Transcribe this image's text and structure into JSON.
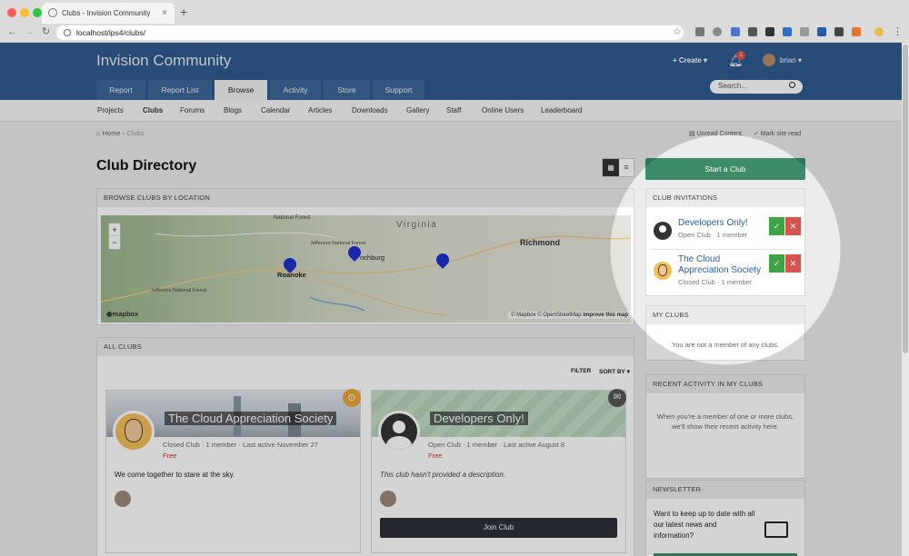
{
  "browser": {
    "tab_title": "Clubs - Invision Community",
    "url": "localhost/ips4/clubs/",
    "new_tab": "+"
  },
  "header": {
    "site_name": "Invision Community",
    "create_label": "Create",
    "notification_count": "1",
    "user_name": "brian",
    "search_placeholder": "Search...",
    "tabs": [
      "Report",
      "Report List",
      "Browse",
      "Activity",
      "Store",
      "Support"
    ],
    "active_tab": "Browse"
  },
  "subnav": {
    "items": [
      "Projects",
      "Clubs",
      "Forums",
      "Blogs",
      "Calendar",
      "Articles",
      "Downloads",
      "Gallery",
      "Staff",
      "Online Users",
      "Leaderboard"
    ],
    "active": "Clubs"
  },
  "breadcrumb": {
    "home": "Home",
    "current": "Clubs",
    "separator": "›",
    "unread": "Unread Content",
    "mark_read": "Mark site read"
  },
  "page_title": "Club Directory",
  "map": {
    "heading": "BROWSE CLUBS BY LOCATION",
    "labels": [
      "Virginia",
      "Richmond",
      "Roanoke",
      "nchburg",
      "National Forest",
      "Jefferson National Forest",
      "Jefferson National Forest"
    ],
    "zoom_in": "+",
    "zoom_out": "−",
    "brand": "mapbox",
    "attribution": "© Mapbox © OpenStreetMap",
    "improve": "Improve this map"
  },
  "all_clubs": {
    "heading": "ALL CLUBS",
    "filter": "FILTER",
    "sort": "SORT BY",
    "clubs": [
      {
        "name": "The Cloud Appreciation Society",
        "type": "Closed Club",
        "members": "1 member",
        "last_active": "Last active November 27",
        "price": "Free",
        "description": "We come together to stare at the sky."
      },
      {
        "name": "Developers Only!",
        "type": "Open Club",
        "members": "1 member",
        "last_active": "Last active August 8",
        "price": "Free",
        "description": "This club hasn't provided a description.",
        "join_label": "Join Club"
      }
    ]
  },
  "sidebar": {
    "start_club": "Start a Club",
    "invitations_heading": "CLUB INVITATIONS",
    "invitations": [
      {
        "name": "Developers Only!",
        "type": "Open Club",
        "members": "1 member"
      },
      {
        "name_line1": "The Cloud",
        "name_line2": "Appreciation Society",
        "type": "Closed Club",
        "members": "1 member"
      }
    ],
    "my_clubs_heading": "MY CLUBS",
    "my_clubs_empty": "You are not a member of any clubs.",
    "recent_heading": "RECENT ACTIVITY IN MY CLUBS",
    "recent_line1": "When you're a member of one or more clubs,",
    "recent_line2": "we'll show their recent activity here.",
    "newsletter_heading": "NEWSLETTER",
    "newsletter_line1": "Want to keep up to date with all",
    "newsletter_line2": "our latest news and",
    "newsletter_line3": "information?"
  },
  "colors": {
    "header": "#2d5a8e",
    "primary_button": "#3c8c6a",
    "accept": "#3ba545",
    "reject": "#d9534f",
    "link": "#2a5b9b"
  }
}
